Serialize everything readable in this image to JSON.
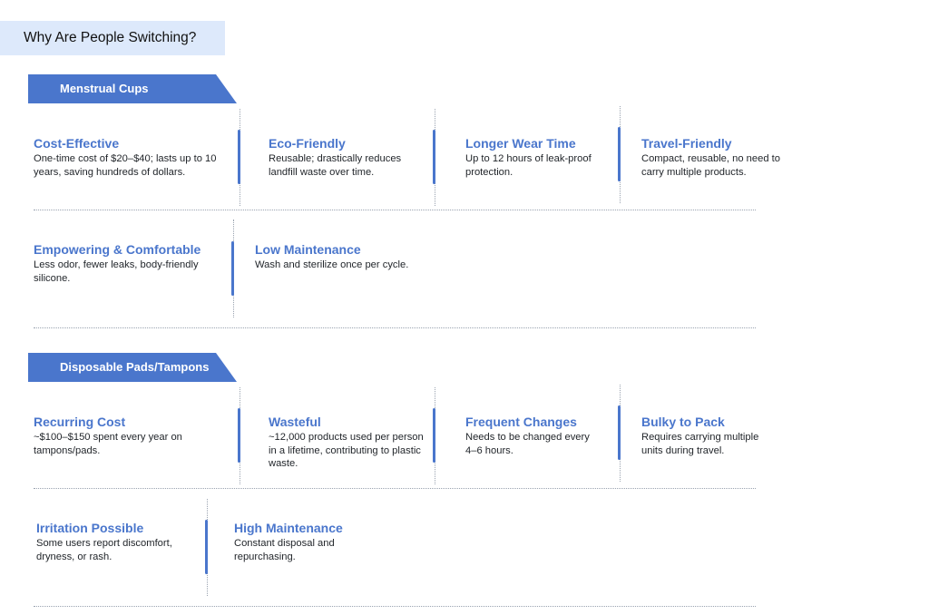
{
  "page": {
    "title": "Why Are People Switching?"
  },
  "sections": [
    {
      "banner": "Menstrual Cups",
      "items": [
        {
          "title": "Cost-Effective",
          "desc": "One-time cost of $20–$40; lasts up to 10 years, saving hundreds of dollars."
        },
        {
          "title": "Eco-Friendly",
          "desc": "Reusable; drastically reduces landfill waste over time."
        },
        {
          "title": "Longer Wear Time",
          "desc": "Up to 12 hours of leak-proof protection."
        },
        {
          "title": "Travel-Friendly",
          "desc": "Compact, reusable, no need to carry multiple products."
        },
        {
          "title": "Empowering & Comfortable",
          "desc": "Less odor, fewer leaks, body-friendly silicone."
        },
        {
          "title": "Low Maintenance",
          "desc": "Wash and sterilize once per cycle."
        }
      ]
    },
    {
      "banner": "Disposable Pads/Tampons",
      "items": [
        {
          "title": "Recurring Cost",
          "desc": "~$100–$150 spent every year on tampons/pads."
        },
        {
          "title": "Wasteful",
          "desc": "~12,000 products used per person in a lifetime, contributing to plastic waste."
        },
        {
          "title": "Frequent Changes",
          "desc": "Needs to be changed every 4–6 hours."
        },
        {
          "title": "Bulky to Pack",
          "desc": "Requires carrying multiple units during travel."
        },
        {
          "title": "Irritation Possible",
          "desc": "Some users report discomfort, dryness, or rash."
        },
        {
          "title": "High Maintenance",
          "desc": "Constant disposal and repurchasing."
        }
      ]
    }
  ]
}
